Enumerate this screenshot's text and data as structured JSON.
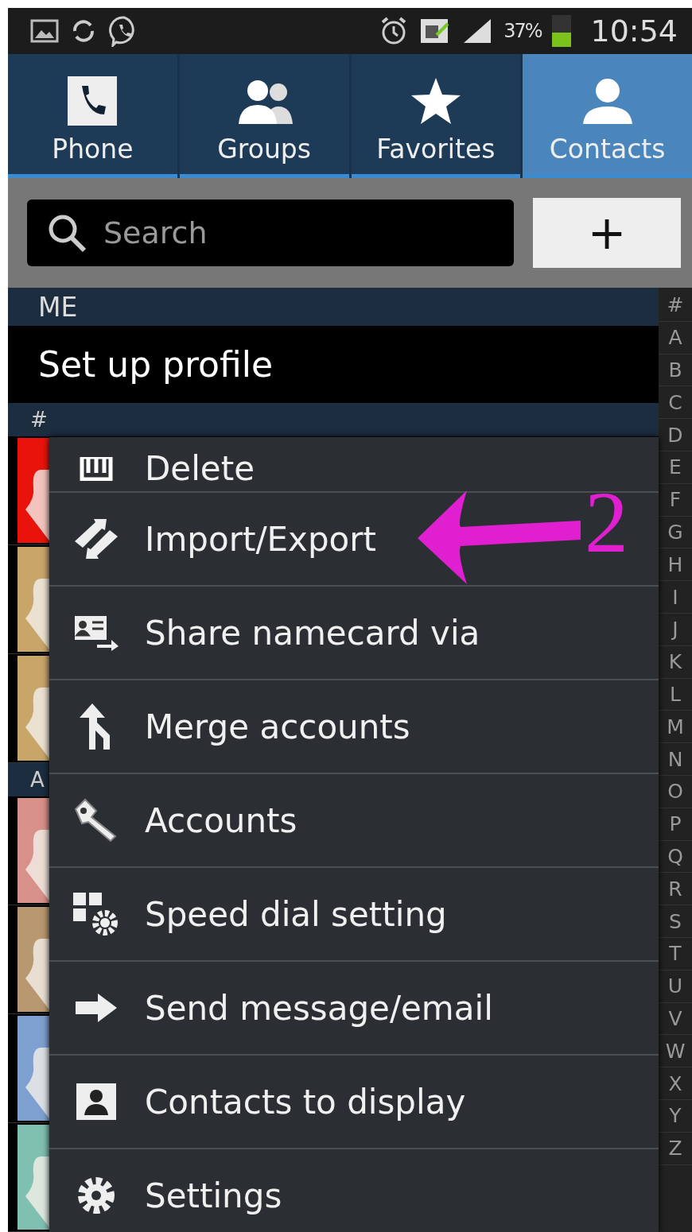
{
  "status_bar": {
    "battery_text": "37%",
    "time": "10:54"
  },
  "tabs": [
    {
      "label": "Phone",
      "kind": "phone",
      "selected": false
    },
    {
      "label": "Groups",
      "kind": "groups",
      "selected": false
    },
    {
      "label": "Favorites",
      "kind": "star",
      "selected": false
    },
    {
      "label": "Contacts",
      "kind": "person",
      "selected": true
    }
  ],
  "search": {
    "placeholder": "Search"
  },
  "add_button": {
    "label": "+"
  },
  "me_header": "ME",
  "profile": "Set up profile",
  "contacts": [
    {
      "kind": "header",
      "label": "#"
    },
    {
      "kind": "contact",
      "color": "#e8140c"
    },
    {
      "kind": "contact",
      "color": "#c8a66a"
    },
    {
      "kind": "contact",
      "color": "#c8a66a"
    },
    {
      "kind": "header",
      "label": "A"
    },
    {
      "kind": "contact",
      "color": "#d8908a"
    },
    {
      "kind": "contact",
      "color": "#b89870"
    },
    {
      "kind": "contact",
      "color": "#7ea0d0"
    },
    {
      "kind": "contact",
      "color": "#80c0b0"
    }
  ],
  "index": [
    "#",
    "A",
    "B",
    "C",
    "D",
    "E",
    "F",
    "G",
    "H",
    "I",
    "J",
    "K",
    "L",
    "M",
    "N",
    "O",
    "P",
    "Q",
    "R",
    "S",
    "T",
    "U",
    "V",
    "W",
    "X",
    "Y",
    "Z"
  ],
  "menu": [
    {
      "label": "Delete",
      "kind": "trash"
    },
    {
      "label": "Import/Export",
      "kind": "swap"
    },
    {
      "label": "Share namecard via",
      "kind": "card"
    },
    {
      "label": "Merge accounts",
      "kind": "merge"
    },
    {
      "label": "Accounts",
      "kind": "key"
    },
    {
      "label": "Speed dial setting",
      "kind": "dial"
    },
    {
      "label": "Send message/email",
      "kind": "arrow"
    },
    {
      "label": "Contacts to display",
      "kind": "contact"
    },
    {
      "label": "Settings",
      "kind": "gear"
    }
  ],
  "annotation": {
    "label": "2"
  }
}
